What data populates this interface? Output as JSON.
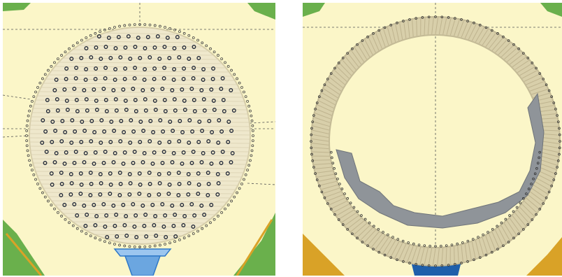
{
  "app": {
    "view": "embroidery-stitch-editor",
    "background_color": "#fbf6c8",
    "guide_color": "#555555",
    "stitch_point_color": "#222222"
  },
  "panels": [
    {
      "id": "left",
      "content": "golf-ball-satin-fill",
      "fill_thread_color": "#efe8cc",
      "tee_color": "#2f78c8",
      "corner_color": "#6ab04c"
    },
    {
      "id": "right",
      "content": "golf-ball-ring-outline",
      "ring_thread_color": "#d8cfaa",
      "shadow_color": "#8f9499",
      "tee_color": "#1f5faa",
      "corner_color": "#d9a227"
    }
  ]
}
